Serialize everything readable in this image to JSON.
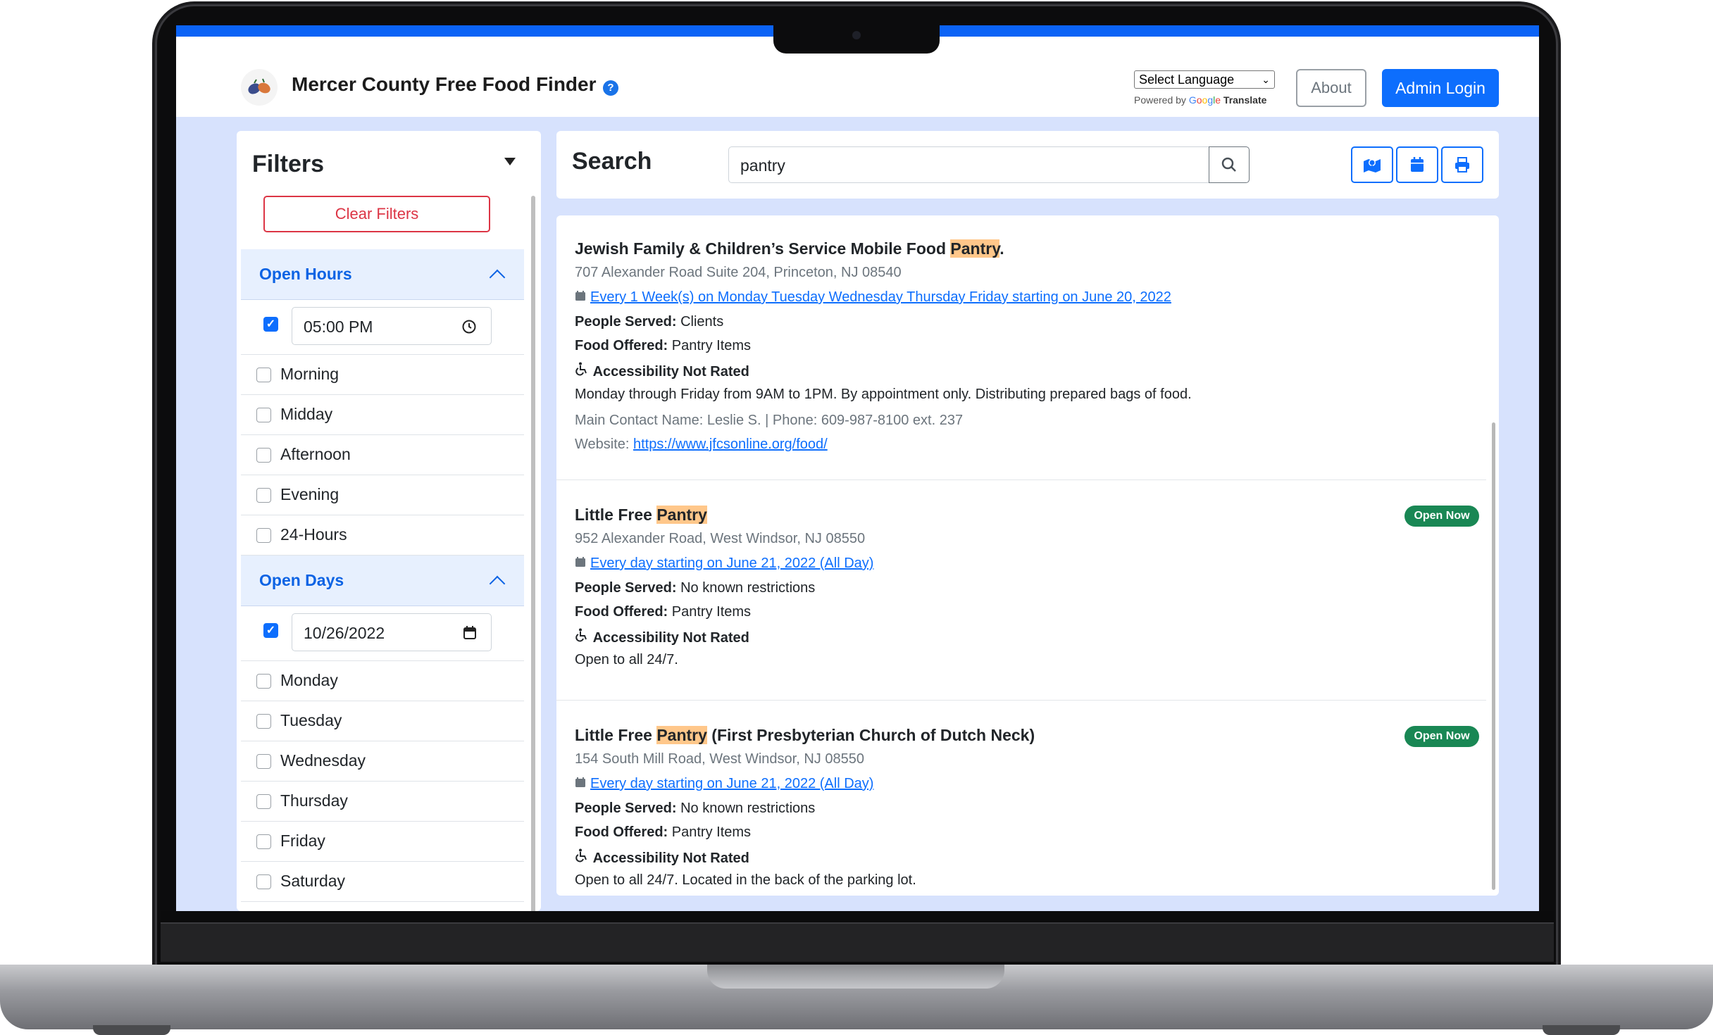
{
  "header": {
    "title": "Mercer County Free Food Finder",
    "help_icon": "?",
    "language_select": "Select Language",
    "powered_by": "Powered by",
    "google": [
      "G",
      "o",
      "o",
      "g",
      "l",
      "e"
    ],
    "translate": "Translate",
    "about_label": "About",
    "admin_label": "Admin Login",
    "accent_color": "#0d6efd"
  },
  "filters": {
    "title": "Filters",
    "clear_label": "Clear Filters",
    "open_hours": {
      "heading": "Open Hours",
      "time_value": "05:00 PM",
      "options": [
        "Morning",
        "Midday",
        "Afternoon",
        "Evening",
        "24-Hours"
      ]
    },
    "open_days": {
      "heading": "Open Days",
      "date_value": "10/26/2022",
      "options": [
        "Monday",
        "Tuesday",
        "Wednesday",
        "Thursday",
        "Friday",
        "Saturday"
      ]
    }
  },
  "search": {
    "title": "Search",
    "value": "pantry",
    "tools": [
      "map-icon",
      "calendar-icon",
      "print-icon"
    ]
  },
  "results": [
    {
      "title_pre": "Jewish Family & Children’s Service Mobile Food ",
      "title_hl": "Pantry",
      "title_post": ".",
      "address": "707 Alexander Road Suite 204, Princeton, NJ 08540",
      "schedule": "Every 1 Week(s) on Monday Tuesday Wednesday Thursday Friday starting on June 20, 2022",
      "people_label": "People Served:",
      "people": "Clients",
      "food_label": "Food Offered:",
      "food": "Pantry Items",
      "access": "Accessibility Not Rated",
      "description": "Monday through Friday from 9AM to 1PM. By appointment only. Distributing prepared bags of food.",
      "contact": "Main Contact Name: Leslie S. | Phone: 609-987-8100 ext. 237",
      "website_label": "Website:",
      "website": "https://www.jfcsonline.org/food/"
    },
    {
      "title_pre": "Little Free ",
      "title_hl": "Pantry",
      "title_post": "",
      "badge": "Open Now",
      "address": "952 Alexander Road, West Windsor, NJ 08550",
      "schedule": "Every day starting on June 21, 2022 (All Day)",
      "people_label": "People Served:",
      "people": "No known restrictions",
      "food_label": "Food Offered:",
      "food": "Pantry Items",
      "access": "Accessibility Not Rated",
      "description": "Open to all 24/7."
    },
    {
      "title_pre": "Little Free ",
      "title_hl": "Pantry",
      "title_post": " (First Presbyterian Church of Dutch Neck)",
      "badge": "Open Now",
      "address": "154 South Mill Road, West Windsor, NJ 08550",
      "schedule": "Every day starting on June 21, 2022 (All Day)",
      "people_label": "People Served:",
      "people": "No known restrictions",
      "food_label": "Food Offered:",
      "food": "Pantry Items",
      "access": "Accessibility Not Rated",
      "description": "Open to all 24/7. Located in the back of the parking lot."
    }
  ]
}
